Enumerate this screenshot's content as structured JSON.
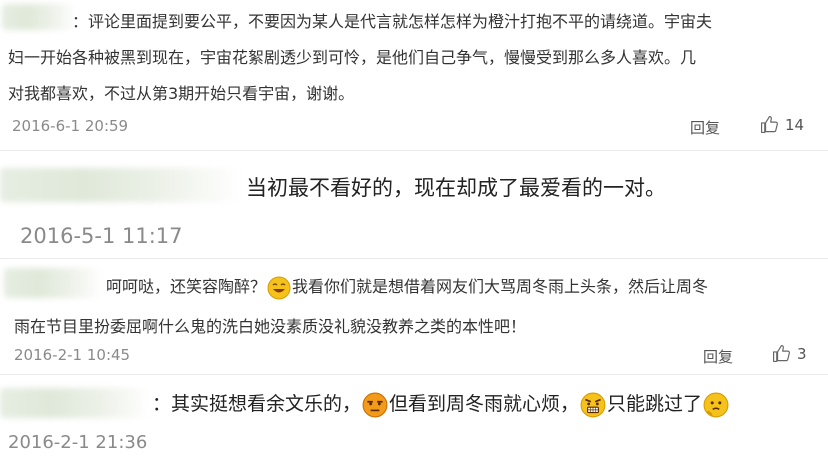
{
  "comments": [
    {
      "lines": [
        "：评论里面提到要公平，不要因为某人是代言就怎样怎样为橙汁打抱不平的请绕道。宇宙夫",
        "妇一开始各种被黑到现在，宇宙花絮剧透少到可怜，是他们自己争气，慢慢受到那么多人喜欢。几",
        "对我都喜欢，不过从第3期开始只看宇宙，谢谢。"
      ],
      "time": "2016-6-1 20:59",
      "reply": "回复",
      "likes": "14"
    },
    {
      "text": "当初最不看好的，现在却成了最爱看的一对。",
      "time": "2016-5-1 11:17"
    },
    {
      "line1_a": "呵呵哒，还笑容陶醉？",
      "line1_b": "我看你们就是想借着网友们大骂周冬雨上头条，然后让周冬",
      "line2": "雨在节目里扮委屈啊什么鬼的洗白她没素质没礼貌没教养之类的本性吧！",
      "time": "2016-2-1 10:45",
      "reply": "回复",
      "likes": "3"
    },
    {
      "text_a": "：其实挺想看余文乐的，",
      "text_b": "但看到周冬雨就心烦，",
      "text_c": "只能跳过了",
      "time": "2016-2-1 21:36"
    }
  ],
  "icons": {
    "like": "thumbs-up-icon",
    "emoji_1": "laughing-face-emoji",
    "emoji_2": "annoyed-face-emoji",
    "emoji_3": "angry-face-emoji",
    "emoji_4": "thinking-face-emoji"
  },
  "colors": {
    "text": "#333333",
    "time": "#8a8a8a",
    "emoji": "#f5c21b"
  }
}
